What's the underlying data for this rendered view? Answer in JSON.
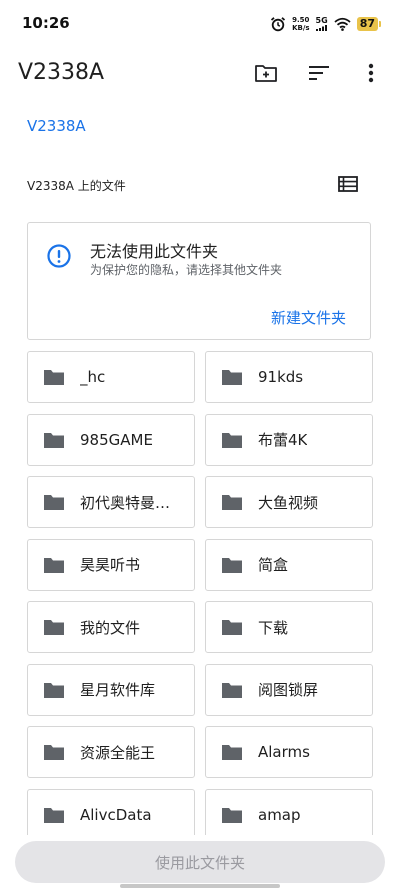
{
  "status_bar": {
    "time": "10:26",
    "net_speed_value": "9.50",
    "net_speed_unit": "KB/s",
    "network_gen": "5G",
    "battery": "87"
  },
  "app_bar": {
    "title": "V2338A",
    "actions": [
      "new-folder-icon",
      "sort-icon",
      "more-vert-icon"
    ]
  },
  "breadcrumb": "V2338A",
  "section": {
    "title": "V2338A 上的文件",
    "view_toggle_icon": "list-view-icon"
  },
  "warning_card": {
    "icon": "info-icon",
    "title": "无法使用此文件夹",
    "subtitle": "为保护您的隐私，请选择其他文件夹",
    "action_label": "新建文件夹"
  },
  "folders": [
    {
      "name": "_hc"
    },
    {
      "name": "91kds"
    },
    {
      "name": "985GAME"
    },
    {
      "name": "布蕾4K"
    },
    {
      "name": "初代奥特曼…"
    },
    {
      "name": "大鱼视频"
    },
    {
      "name": "昊昊听书"
    },
    {
      "name": "简盒"
    },
    {
      "name": "我的文件"
    },
    {
      "name": "下载"
    },
    {
      "name": "星月软件库"
    },
    {
      "name": "阅图锁屏"
    },
    {
      "name": "资源全能王"
    },
    {
      "name": "Alarms"
    },
    {
      "name": "AlivcData"
    },
    {
      "name": "amap"
    }
  ],
  "bottom_button": {
    "label": "使用此文件夹"
  },
  "colors": {
    "accent": "#1a73e8",
    "folder_icon": "#5f6368",
    "battery": "#e9c34a",
    "disabled_button_bg": "#e4e4e7"
  }
}
